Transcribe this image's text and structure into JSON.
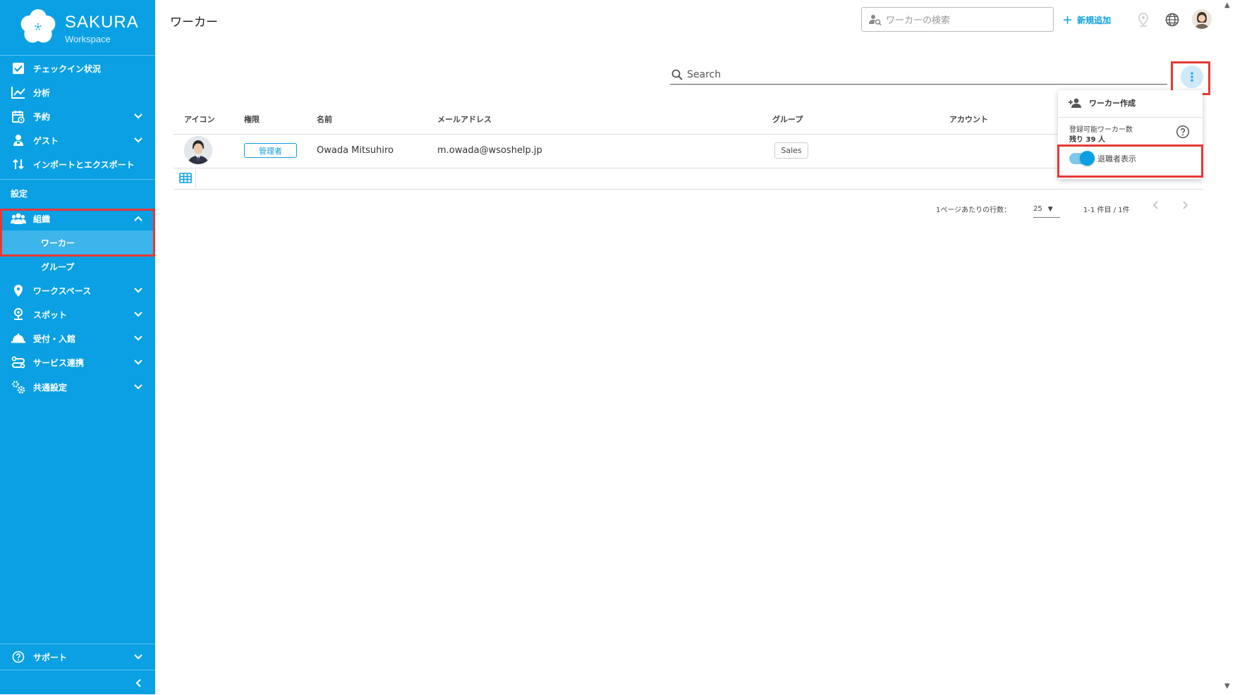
{
  "app": {
    "brand_title": "SAKURA",
    "brand_subtitle": "Workspace",
    "page_title": "ワーカー"
  },
  "header": {
    "search_placeholder": "ワーカーの検索",
    "add_label": "新規追加"
  },
  "sidebar": {
    "items": [
      {
        "label": "チェックイン状況",
        "icon": "checkbox-icon"
      },
      {
        "label": "分析",
        "icon": "chart-icon"
      },
      {
        "label": "予約",
        "icon": "calendar-icon"
      },
      {
        "label": "ゲスト",
        "icon": "guest-icon"
      },
      {
        "label": "インポートとエクスポート",
        "icon": "import-export-icon"
      }
    ],
    "section_label": "設定",
    "org": {
      "label": "組織",
      "sub_items": [
        "ワーカー",
        "グループ"
      ]
    },
    "settings_items": [
      {
        "label": "ワークスペース",
        "icon": "map-pin-icon"
      },
      {
        "label": "スポット",
        "icon": "spot-pin-icon"
      },
      {
        "label": "受付・入館",
        "icon": "reception-icon"
      },
      {
        "label": "サービス連携",
        "icon": "integration-icon"
      },
      {
        "label": "共通設定",
        "icon": "gears-icon"
      }
    ],
    "support_label": "サポート"
  },
  "main": {
    "search_placeholder": "Search",
    "columns": [
      "アイコン",
      "権限",
      "名前",
      "メールアドレス",
      "グループ",
      "アカウント"
    ],
    "rows": [
      {
        "role": "管理者",
        "name": "Owada Mitsuhiro",
        "email": "m.owada@wsoshelp.jp",
        "group": "Sales"
      }
    ],
    "pagination": {
      "rows_per_page_label": "1ページあたりの行数：",
      "rows_per_page": "25",
      "range": "1-1 件目 / 1件"
    }
  },
  "menu": {
    "create_worker": "ワーカー作成",
    "remaining_label": "登録可能ワーカー数",
    "remaining_value": "残り 39 人",
    "show_retired": "退職者表示",
    "show_retired_on": true
  },
  "colors": {
    "brand": "#0aa0e3",
    "highlight": "#e53935"
  }
}
